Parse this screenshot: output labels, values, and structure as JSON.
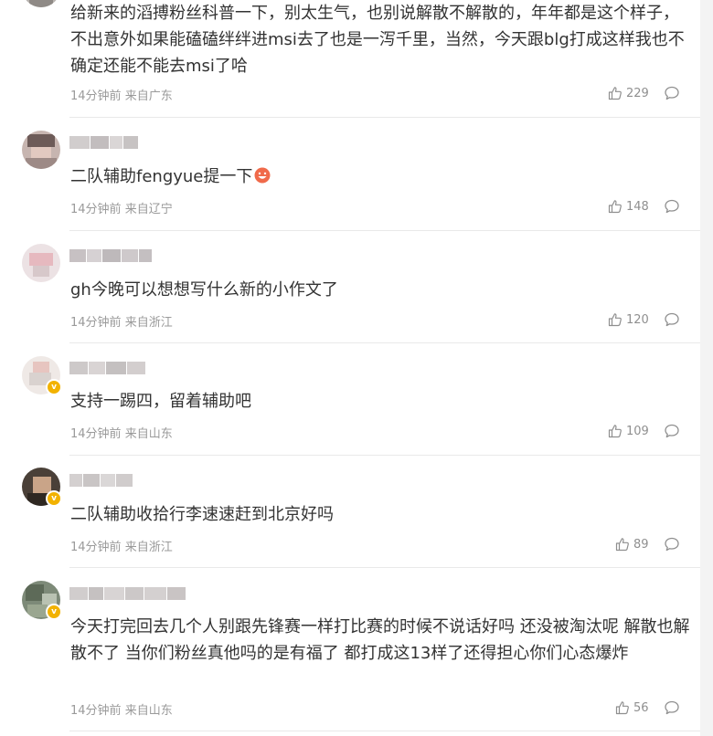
{
  "comments": [
    {
      "username": "",
      "verified": false,
      "text": "给新来的滔搏粉丝科普一下，别太生气，也别说解散不解散的，年年都是这个样子，不出意外如果能磕磕绊绊进msi去了也是一泻千里，当然，今天跟blg打成这样我也不确定还能不能去msi了哈",
      "time": "14分钟前",
      "location": "来自广东",
      "likes": "229"
    },
    {
      "username": "",
      "verified": false,
      "text": "二队辅助fengyue提一下",
      "emoji": "smiling-face-emoji",
      "time": "14分钟前",
      "location": "来自辽宁",
      "likes": "148"
    },
    {
      "username": "",
      "verified": false,
      "text": "gh今晚可以想想写什么新的小作文了",
      "time": "14分钟前",
      "location": "来自浙江",
      "likes": "120"
    },
    {
      "username": "",
      "verified": true,
      "text": "支持一踢四，留着辅助吧",
      "time": "14分钟前",
      "location": "来自山东",
      "likes": "109"
    },
    {
      "username": "",
      "verified": true,
      "text": "二队辅助收拾行李速速赶到北京好吗",
      "time": "14分钟前",
      "location": "来自浙江",
      "likes": "89"
    },
    {
      "username": "",
      "verified": true,
      "text": "今天打完回去几个人别跟先锋赛一样打比赛的时候不说话好吗 还没被淘汰呢 解散也解散不了 当你们粉丝真他吗的是有福了 都打成这13样了还得担心你们心态爆炸",
      "time": "14分钟前",
      "location": "来自山东",
      "likes": "56"
    }
  ],
  "icons": {
    "like": "thumbs-up-icon",
    "reply": "comment-bubble-icon",
    "verified": "verified-badge-icon"
  },
  "colors": {
    "text": "#333333",
    "meta": "#9a9a9a",
    "divider": "#e9e9e9",
    "verified": "#f2b200"
  }
}
